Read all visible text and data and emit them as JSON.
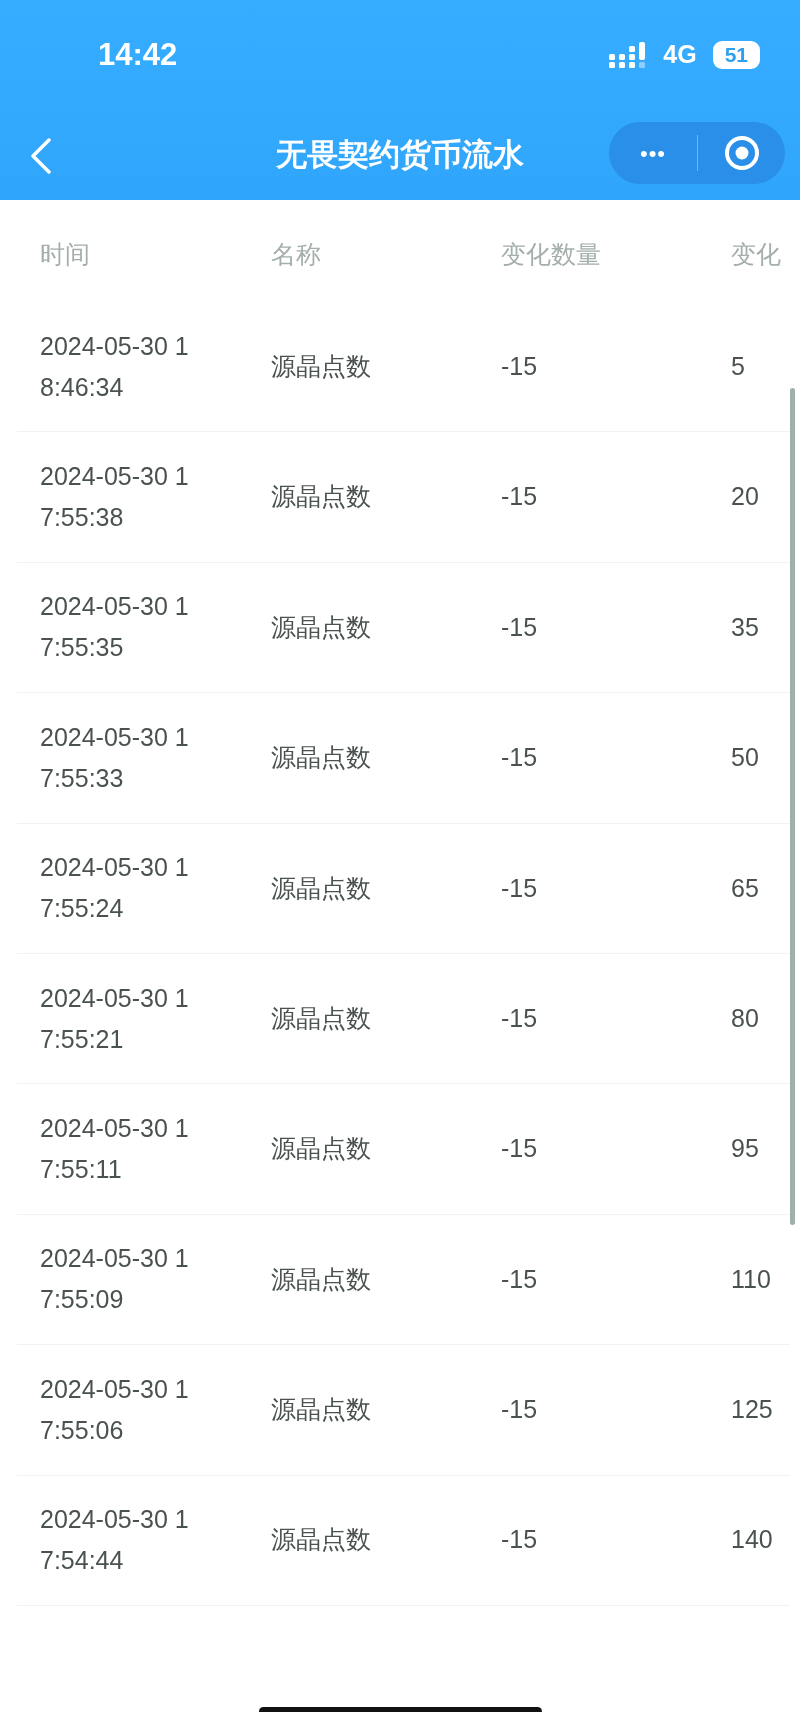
{
  "status_bar": {
    "time": "14:42",
    "network": "4G",
    "battery": "51"
  },
  "nav": {
    "title": "无畏契约货币流水",
    "more": "•••"
  },
  "table": {
    "columns": [
      "时间",
      "名称",
      "变化数量",
      "变化"
    ],
    "rows": [
      {
        "time": "2024-05-30 18:46:34",
        "name": "源晶点数",
        "change": "-15",
        "after": "5"
      },
      {
        "time": "2024-05-30 17:55:38",
        "name": "源晶点数",
        "change": "-15",
        "after": "20"
      },
      {
        "time": "2024-05-30 17:55:35",
        "name": "源晶点数",
        "change": "-15",
        "after": "35"
      },
      {
        "time": "2024-05-30 17:55:33",
        "name": "源晶点数",
        "change": "-15",
        "after": "50"
      },
      {
        "time": "2024-05-30 17:55:24",
        "name": "源晶点数",
        "change": "-15",
        "after": "65"
      },
      {
        "time": "2024-05-30 17:55:21",
        "name": "源晶点数",
        "change": "-15",
        "after": "80"
      },
      {
        "time": "2024-05-30 17:55:11",
        "name": "源晶点数",
        "change": "-15",
        "after": "95"
      },
      {
        "time": "2024-05-30 17:55:09",
        "name": "源晶点数",
        "change": "-15",
        "after": "110"
      },
      {
        "time": "2024-05-30 17:55:06",
        "name": "源晶点数",
        "change": "-15",
        "after": "125"
      },
      {
        "time": "2024-05-30 17:54:44",
        "name": "源晶点数",
        "change": "-15",
        "after": "140"
      }
    ]
  }
}
